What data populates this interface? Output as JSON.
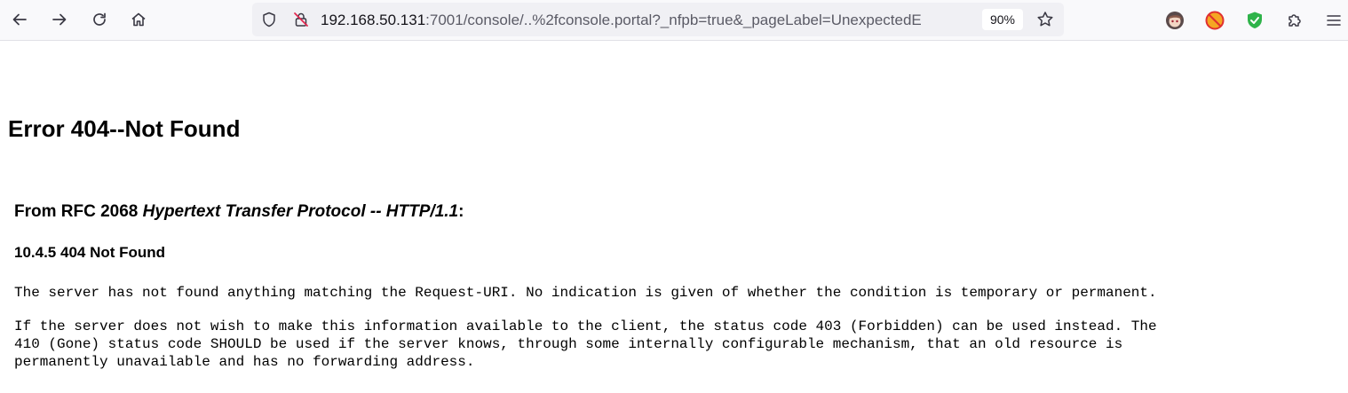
{
  "browser": {
    "url_host": "192.168.50.131",
    "url_rest": ":7001/console/..%2fconsole.portal?_nfpb=true&_pageLabel=UnexpectedE",
    "zoom": "90%",
    "icons": {
      "back": "back-arrow-icon",
      "forward": "forward-arrow-icon",
      "reload": "reload-icon",
      "home": "home-icon",
      "tracking": "shield-icon",
      "insecure": "insecure-lock-icon",
      "bookmark": "star-icon",
      "ext1": "anime-avatar-extension-icon",
      "ext2": "blocked-extension-icon",
      "ext3": "green-shield-extension-icon",
      "extensions": "puzzle-icon",
      "menu": "hamburger-menu-icon"
    }
  },
  "page": {
    "title": "Error 404--Not Found",
    "rfc_prefix": "From RFC 2068 ",
    "rfc_italic": "Hypertext Transfer Protocol -- HTTP/1.1",
    "rfc_suffix": ":",
    "section_heading": "10.4.5 404 Not Found",
    "paragraph1": "The server has not found anything matching the Request-URI. No indication is given of whether the condition is temporary or permanent.",
    "paragraph2": "If the server does not wish to make this information available to the client, the status code 403 (Forbidden) can be used instead. The\n410 (Gone) status code SHOULD be used if the server knows, through some internally configurable mechanism, that an old resource is\npermanently unavailable and has no forwarding address."
  }
}
